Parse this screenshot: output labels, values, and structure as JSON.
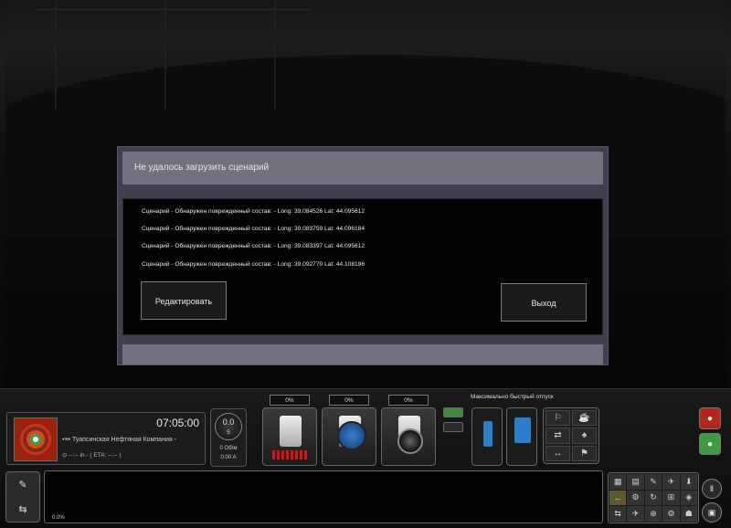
{
  "dialog": {
    "title": "Не удалось загрузить сценарий",
    "messages": [
      "Сценарий - Обнаружен поврежденный состав: - Long: 39.084526 Lat: 44.095612",
      "Сценарий - Обнаружен поврежденный состав: - Long: 39.083759 Lat: 44.096184",
      "Сценарий - Обнаружен поврежденный состав: - Long: 39.083397 Lat: 44.095612",
      "Сценарий - Обнаружен поврежденный состав: - Long: 39.092770 Lat: 44.108196"
    ],
    "edit_label": "Редактировать",
    "exit_label": "Выход"
  },
  "hud": {
    "clock": "07:05:00",
    "route_prefix": "•≡•",
    "route_name": "Туапсинская Нефтяная Компания -",
    "eta_row": "⊙   --:--   in -        ( ETA:   --:-- )",
    "speed": "0.0",
    "speed_sub": "5",
    "rpm": "0 Об/м",
    "current": "0.00 A",
    "lever_pcts": [
      "0%",
      "0%",
      "0%"
    ],
    "release_label": "Максимально быстрый отпуск",
    "message_pct": "0.0%"
  },
  "icons": {
    "grid": [
      "⚐",
      "☕",
      "⇄",
      "♠",
      "↔",
      "⚑"
    ],
    "tools": [
      "▦",
      "▤",
      "✎",
      "✈",
      "⬇",
      "←",
      "⚙",
      "↻",
      "⊞",
      "◈",
      "⇆",
      "✈",
      "⊕",
      "⚙",
      "☗"
    ],
    "side_red": "●",
    "side_green": "●",
    "pause": "Ⅱ",
    "camera": "▣"
  },
  "colors": {
    "dialog_frame": "#3f3f4f",
    "dialog_header": "#72727f",
    "red_button": "#b3261e",
    "green_button": "#3f9b3f",
    "accent_blue": "#2d7ec9"
  }
}
